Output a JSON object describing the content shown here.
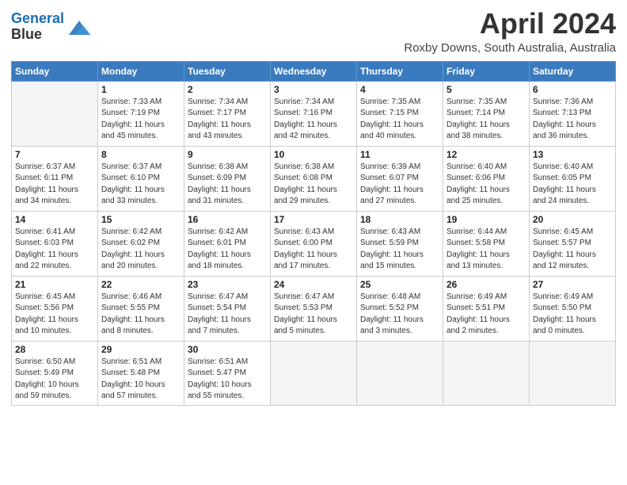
{
  "header": {
    "logo_line1": "General",
    "logo_line2": "Blue",
    "month_title": "April 2024",
    "subtitle": "Roxby Downs, South Australia, Australia"
  },
  "weekdays": [
    "Sunday",
    "Monday",
    "Tuesday",
    "Wednesday",
    "Thursday",
    "Friday",
    "Saturday"
  ],
  "weeks": [
    [
      {
        "day": "",
        "info": ""
      },
      {
        "day": "1",
        "info": "Sunrise: 7:33 AM\nSunset: 7:19 PM\nDaylight: 11 hours\nand 45 minutes."
      },
      {
        "day": "2",
        "info": "Sunrise: 7:34 AM\nSunset: 7:17 PM\nDaylight: 11 hours\nand 43 minutes."
      },
      {
        "day": "3",
        "info": "Sunrise: 7:34 AM\nSunset: 7:16 PM\nDaylight: 11 hours\nand 42 minutes."
      },
      {
        "day": "4",
        "info": "Sunrise: 7:35 AM\nSunset: 7:15 PM\nDaylight: 11 hours\nand 40 minutes."
      },
      {
        "day": "5",
        "info": "Sunrise: 7:35 AM\nSunset: 7:14 PM\nDaylight: 11 hours\nand 38 minutes."
      },
      {
        "day": "6",
        "info": "Sunrise: 7:36 AM\nSunset: 7:13 PM\nDaylight: 11 hours\nand 36 minutes."
      }
    ],
    [
      {
        "day": "7",
        "info": "Sunrise: 6:37 AM\nSunset: 6:11 PM\nDaylight: 11 hours\nand 34 minutes."
      },
      {
        "day": "8",
        "info": "Sunrise: 6:37 AM\nSunset: 6:10 PM\nDaylight: 11 hours\nand 33 minutes."
      },
      {
        "day": "9",
        "info": "Sunrise: 6:38 AM\nSunset: 6:09 PM\nDaylight: 11 hours\nand 31 minutes."
      },
      {
        "day": "10",
        "info": "Sunrise: 6:38 AM\nSunset: 6:08 PM\nDaylight: 11 hours\nand 29 minutes."
      },
      {
        "day": "11",
        "info": "Sunrise: 6:39 AM\nSunset: 6:07 PM\nDaylight: 11 hours\nand 27 minutes."
      },
      {
        "day": "12",
        "info": "Sunrise: 6:40 AM\nSunset: 6:06 PM\nDaylight: 11 hours\nand 25 minutes."
      },
      {
        "day": "13",
        "info": "Sunrise: 6:40 AM\nSunset: 6:05 PM\nDaylight: 11 hours\nand 24 minutes."
      }
    ],
    [
      {
        "day": "14",
        "info": "Sunrise: 6:41 AM\nSunset: 6:03 PM\nDaylight: 11 hours\nand 22 minutes."
      },
      {
        "day": "15",
        "info": "Sunrise: 6:42 AM\nSunset: 6:02 PM\nDaylight: 11 hours\nand 20 minutes."
      },
      {
        "day": "16",
        "info": "Sunrise: 6:42 AM\nSunset: 6:01 PM\nDaylight: 11 hours\nand 18 minutes."
      },
      {
        "day": "17",
        "info": "Sunrise: 6:43 AM\nSunset: 6:00 PM\nDaylight: 11 hours\nand 17 minutes."
      },
      {
        "day": "18",
        "info": "Sunrise: 6:43 AM\nSunset: 5:59 PM\nDaylight: 11 hours\nand 15 minutes."
      },
      {
        "day": "19",
        "info": "Sunrise: 6:44 AM\nSunset: 5:58 PM\nDaylight: 11 hours\nand 13 minutes."
      },
      {
        "day": "20",
        "info": "Sunrise: 6:45 AM\nSunset: 5:57 PM\nDaylight: 11 hours\nand 12 minutes."
      }
    ],
    [
      {
        "day": "21",
        "info": "Sunrise: 6:45 AM\nSunset: 5:56 PM\nDaylight: 11 hours\nand 10 minutes."
      },
      {
        "day": "22",
        "info": "Sunrise: 6:46 AM\nSunset: 5:55 PM\nDaylight: 11 hours\nand 8 minutes."
      },
      {
        "day": "23",
        "info": "Sunrise: 6:47 AM\nSunset: 5:54 PM\nDaylight: 11 hours\nand 7 minutes."
      },
      {
        "day": "24",
        "info": "Sunrise: 6:47 AM\nSunset: 5:53 PM\nDaylight: 11 hours\nand 5 minutes."
      },
      {
        "day": "25",
        "info": "Sunrise: 6:48 AM\nSunset: 5:52 PM\nDaylight: 11 hours\nand 3 minutes."
      },
      {
        "day": "26",
        "info": "Sunrise: 6:49 AM\nSunset: 5:51 PM\nDaylight: 11 hours\nand 2 minutes."
      },
      {
        "day": "27",
        "info": "Sunrise: 6:49 AM\nSunset: 5:50 PM\nDaylight: 11 hours\nand 0 minutes."
      }
    ],
    [
      {
        "day": "28",
        "info": "Sunrise: 6:50 AM\nSunset: 5:49 PM\nDaylight: 10 hours\nand 59 minutes."
      },
      {
        "day": "29",
        "info": "Sunrise: 6:51 AM\nSunset: 5:48 PM\nDaylight: 10 hours\nand 57 minutes."
      },
      {
        "day": "30",
        "info": "Sunrise: 6:51 AM\nSunset: 5:47 PM\nDaylight: 10 hours\nand 55 minutes."
      },
      {
        "day": "",
        "info": ""
      },
      {
        "day": "",
        "info": ""
      },
      {
        "day": "",
        "info": ""
      },
      {
        "day": "",
        "info": ""
      }
    ]
  ]
}
